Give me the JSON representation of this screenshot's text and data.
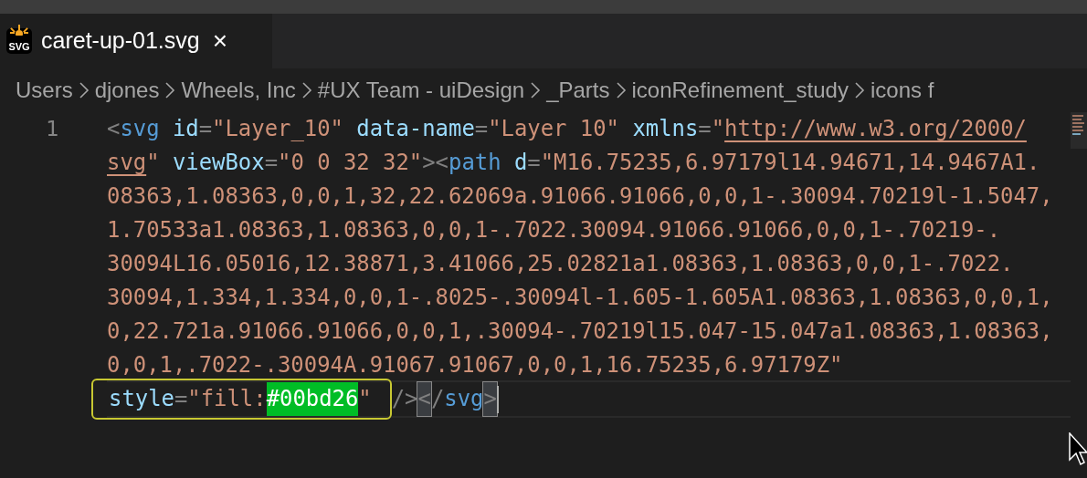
{
  "tab": {
    "icon_label": "SVG",
    "title": "caret-up-01.svg",
    "close": "×",
    "selected": true
  },
  "breadcrumbs": [
    "Users",
    "djones",
    "Wheels, Inc",
    "#UX Team - uiDesign",
    "_Parts",
    "iconRefinement_study",
    "icons f"
  ],
  "editor": {
    "line_number": "1",
    "lines": [
      {
        "current": false,
        "tokens": [
          {
            "kind": "punct",
            "text": "<"
          },
          {
            "kind": "tag",
            "text": "svg"
          },
          {
            "kind": "attr",
            "text": " id"
          },
          {
            "kind": "punct",
            "text": "="
          },
          {
            "kind": "string",
            "text": "\"Layer_10\""
          },
          {
            "kind": "attr",
            "text": " data-name"
          },
          {
            "kind": "punct",
            "text": "="
          },
          {
            "kind": "string",
            "text": "\"Layer 10\""
          },
          {
            "kind": "attr",
            "text": " xmlns"
          },
          {
            "kind": "punct",
            "text": "="
          },
          {
            "kind": "string",
            "text": "\""
          },
          {
            "kind": "link",
            "text": "http://www.w3.org/2000/"
          }
        ]
      },
      {
        "current": false,
        "tokens": [
          {
            "kind": "link",
            "text": "svg"
          },
          {
            "kind": "string",
            "text": "\""
          },
          {
            "kind": "attr",
            "text": " viewBox"
          },
          {
            "kind": "punct",
            "text": "="
          },
          {
            "kind": "string",
            "text": "\"0 0 32 32\""
          },
          {
            "kind": "punct",
            "text": "><"
          },
          {
            "kind": "tag",
            "text": "path"
          },
          {
            "kind": "attr",
            "text": " d"
          },
          {
            "kind": "punct",
            "text": "="
          },
          {
            "kind": "string",
            "text": "\"M16.75235,6.97179l14.94671,14.9467A1."
          }
        ]
      },
      {
        "current": false,
        "tokens": [
          {
            "kind": "string",
            "text": "08363,1.08363,0,0,1,32,22.62069a.91066.91066,0,0,1-.30094.70219l-1.5047,"
          }
        ]
      },
      {
        "current": false,
        "tokens": [
          {
            "kind": "string",
            "text": "1.70533a1.08363,1.08363,0,0,1-.7022.30094.91066.91066,0,0,1-.70219-."
          }
        ]
      },
      {
        "current": false,
        "tokens": [
          {
            "kind": "string",
            "text": "30094L16.05016,12.38871,3.41066,25.02821a1.08363,1.08363,0,0,1-.7022."
          }
        ]
      },
      {
        "current": false,
        "tokens": [
          {
            "kind": "string",
            "text": "30094,1.334,1.334,0,0,1-.8025-.30094l-1.605-1.605A1.08363,1.08363,0,0,1,"
          }
        ]
      },
      {
        "current": false,
        "tokens": [
          {
            "kind": "string",
            "text": "0,22.721a.91066.91066,0,0,1,.30094-.70219l15.047-15.047a1.08363,1.08363,"
          }
        ]
      },
      {
        "current": false,
        "tokens": [
          {
            "kind": "string",
            "text": "0,0,1,.7022-.30094A.91067.91067,0,0,1,16.75235,6.97179Z\""
          }
        ]
      },
      {
        "current": true,
        "tokens": [
          {
            "kind": "attr",
            "text": "style",
            "boxed": true
          },
          {
            "kind": "punct",
            "text": "=",
            "boxed": true
          },
          {
            "kind": "string",
            "text": "\"fill:",
            "boxed": true
          },
          {
            "kind": "highlight",
            "text": "#00bd26",
            "boxed": true
          },
          {
            "kind": "string",
            "text": "\"",
            "boxed": true
          },
          {
            "kind": "punct",
            "text": "/>"
          },
          {
            "kind": "bracket",
            "text": "<"
          },
          {
            "kind": "punct",
            "text": "/"
          },
          {
            "kind": "tag",
            "text": "svg"
          },
          {
            "kind": "bracket",
            "text": ">"
          }
        ]
      }
    ]
  }
}
